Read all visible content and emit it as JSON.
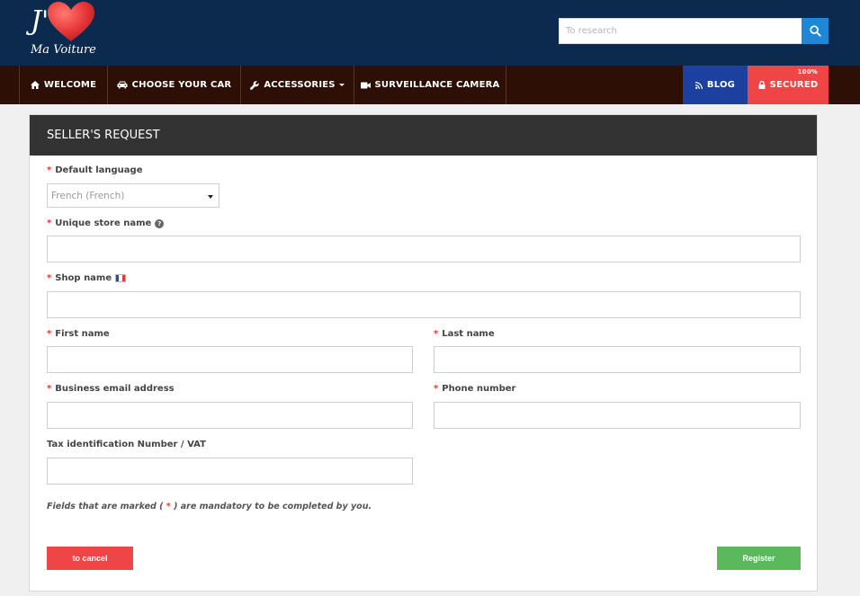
{
  "brand": {
    "logo_line1": "J'",
    "logo_line2": "Ma Voiture",
    "colors": {
      "header": "#0b2a4e",
      "nav": "#2e0f06",
      "heart": "#e8383b"
    }
  },
  "search": {
    "placeholder": "To research",
    "icon": "search-icon"
  },
  "nav": {
    "welcome": "WELCOME",
    "choose_car": "CHOOSE YOUR CAR",
    "accessories": "ACCESSORIES",
    "surveillance": "SURVEILLANCE CAMERA",
    "blog": "BLOG",
    "secured": "SECURED",
    "secured_badge": "100%"
  },
  "form": {
    "title": "SELLER'S REQUEST",
    "default_language_label": "Default language",
    "default_language_value": "French (French)",
    "store_name_label": "Unique store name",
    "shop_name_label": "Shop name",
    "first_name_label": "First name",
    "last_name_label": "Last name",
    "email_label": "Business email address",
    "phone_label": "Phone number",
    "vat_label": "Tax identification Number / VAT",
    "required_marker": "*",
    "note_prefix": "Fields that are marked (",
    "note_suffix": ") are mandatory to be completed by you.",
    "cancel_label": "to cancel",
    "register_label": "Register"
  }
}
